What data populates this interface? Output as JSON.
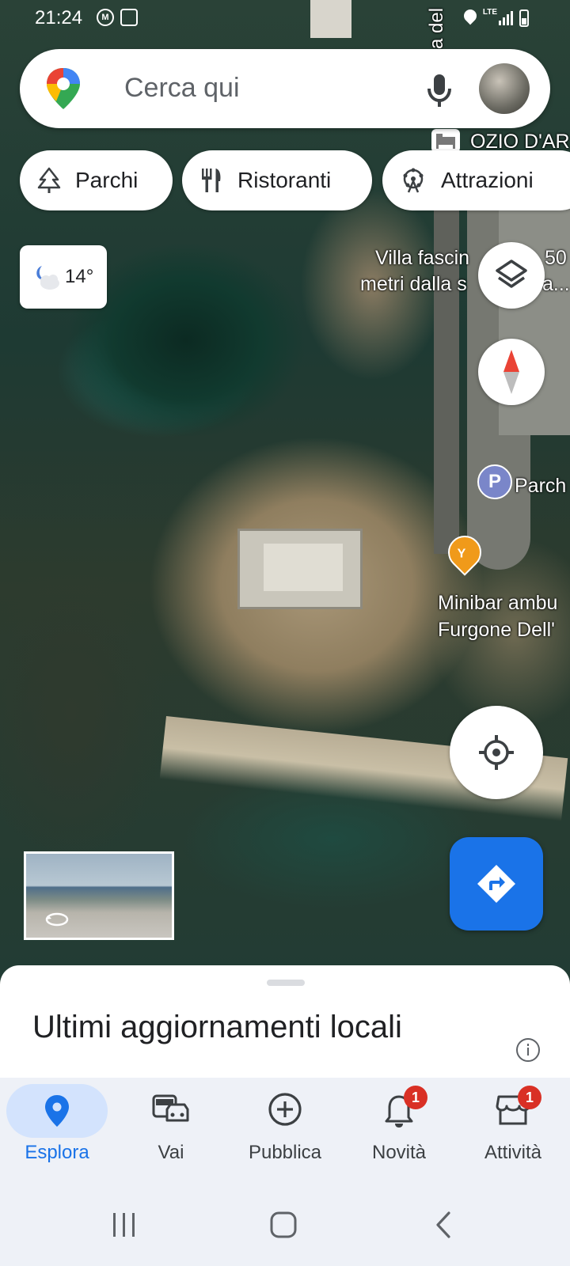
{
  "status_bar": {
    "time": "21:24",
    "network": "LTE"
  },
  "search": {
    "placeholder": "Cerca qui"
  },
  "chips": [
    {
      "label": "Parchi",
      "icon": "tree-icon"
    },
    {
      "label": "Ristoranti",
      "icon": "restaurant-icon"
    },
    {
      "label": "Attrazioni",
      "icon": "attraction-icon"
    }
  ],
  "weather": {
    "temperature": "14°",
    "icon": "moon-cloud-icon"
  },
  "map_labels": {
    "top_road": "a del",
    "hotel": "OZIO D'AR",
    "villa_line1": "Villa fascin",
    "villa_num": "50",
    "villa_line2": "metri dalla s",
    "villa_tail": "a...",
    "parking": "Parch",
    "parking_letter": "P",
    "minibar_line1": "Minibar ambu",
    "minibar_line2": "Furgone Dell'"
  },
  "sheet": {
    "title": "Ultimi aggiornamenti locali"
  },
  "bottom_nav": [
    {
      "label": "Esplora",
      "icon": "location-pin-icon",
      "active": true
    },
    {
      "label": "Vai",
      "icon": "commute-icon"
    },
    {
      "label": "Pubblica",
      "icon": "add-circle-icon"
    },
    {
      "label": "Novità",
      "icon": "bell-icon",
      "badge": "1"
    },
    {
      "label": "Attività",
      "icon": "storefront-icon",
      "badge": "1"
    }
  ],
  "colors": {
    "accent": "#1a73e8",
    "badge": "#d93025",
    "nav_background": "#eef1f7"
  }
}
